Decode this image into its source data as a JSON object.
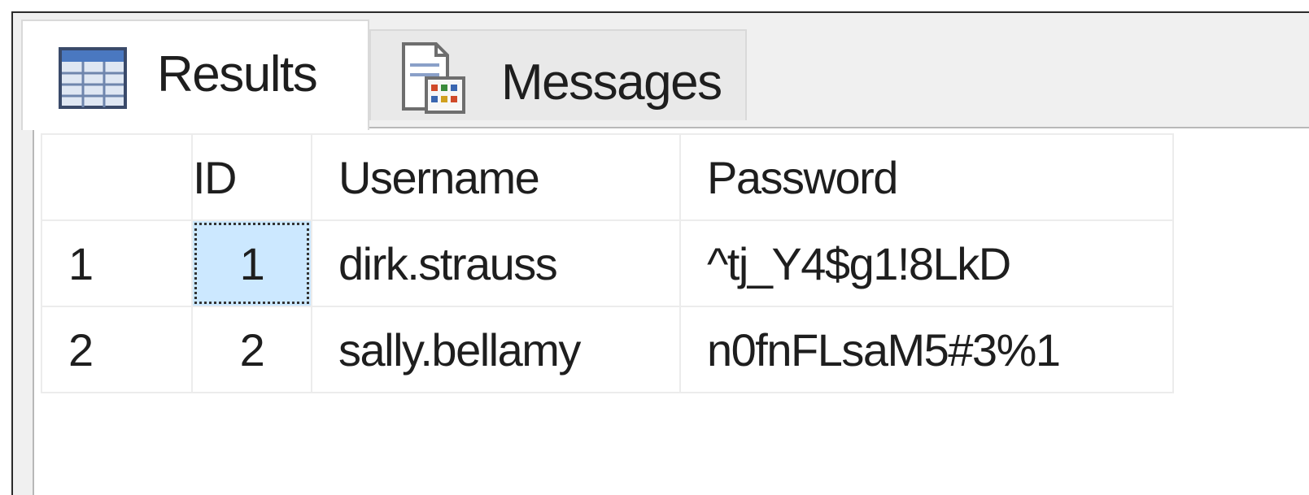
{
  "tabs": [
    {
      "label": "Results",
      "icon": "grid-icon",
      "active": true
    },
    {
      "label": "Messages",
      "icon": "messages-icon",
      "active": false
    }
  ],
  "grid": {
    "columns": [
      "",
      "ID",
      "Username",
      "Password"
    ],
    "rows": [
      {
        "row_number": "1",
        "id": "1",
        "username": "dirk.strauss",
        "password": "^tj_Y4$g1!8LkD"
      },
      {
        "row_number": "2",
        "id": "2",
        "username": "sally.bellamy",
        "password": "n0fnFLsaM5#3%1"
      }
    ],
    "selected_cell": {
      "row": 0,
      "column": "ID"
    }
  },
  "colors": {
    "selection": "#cce8ff",
    "background": "#f0f0f0",
    "grid_line": "#ececec"
  }
}
